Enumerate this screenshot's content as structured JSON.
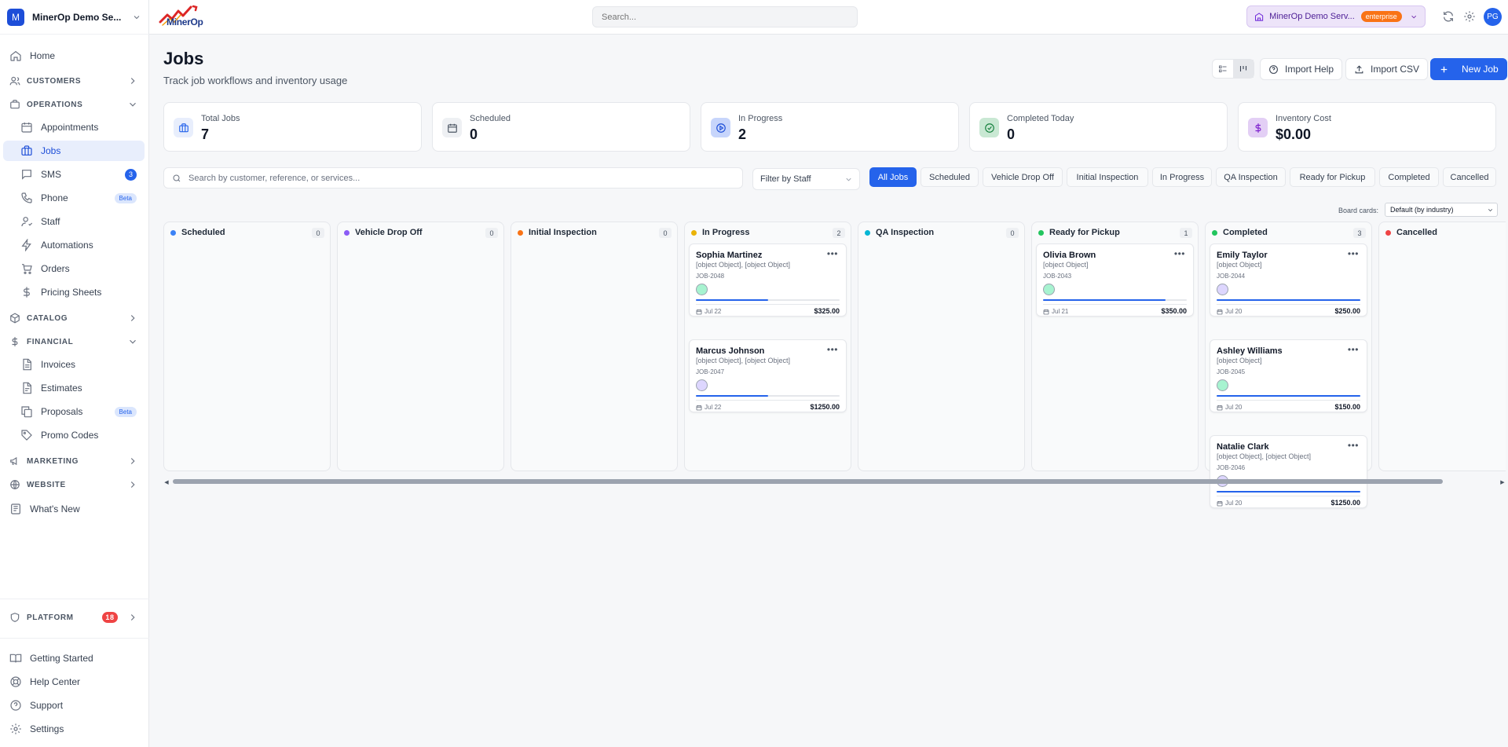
{
  "workspace": {
    "initial": "M",
    "name": "MinerOp Demo Se..."
  },
  "logo_text": "MinerOp",
  "topbar": {
    "search_placeholder": "Search...",
    "business_name": "MinerOp Demo Serv...",
    "plan_badge": "enterprise",
    "user_initials": "PG"
  },
  "sidebar": {
    "home": "Home",
    "sections": {
      "customers": "CUSTOMERS",
      "operations": "OPERATIONS",
      "catalog": "CATALOG",
      "financial": "FINANCIAL",
      "marketing": "MARKETING",
      "website": "WEBSITE",
      "platform": "PLATFORM"
    },
    "operations_items": {
      "appointments": "Appointments",
      "jobs": "Jobs",
      "sms": "SMS",
      "sms_count": "3",
      "phone": "Phone",
      "phone_badge": "Beta",
      "staff": "Staff",
      "automations": "Automations",
      "orders": "Orders",
      "pricing_sheets": "Pricing Sheets"
    },
    "financial_items": {
      "invoices": "Invoices",
      "estimates": "Estimates",
      "proposals": "Proposals",
      "proposals_badge": "Beta",
      "promo_codes": "Promo Codes"
    },
    "whats_new": "What's New",
    "platform_count": "18",
    "footer": {
      "getting_started": "Getting Started",
      "help_center": "Help Center",
      "support": "Support",
      "settings": "Settings"
    }
  },
  "page": {
    "title": "Jobs",
    "subtitle": "Track job workflows and inventory usage",
    "import_help": "Import Help",
    "import_csv": "Import CSV",
    "new_job": "New Job"
  },
  "stats": {
    "total": {
      "label": "Total Jobs",
      "value": "7",
      "color": "#2563eb"
    },
    "scheduled": {
      "label": "Scheduled",
      "value": "0",
      "color": "#4b5563"
    },
    "in_progress": {
      "label": "In Progress",
      "value": "2",
      "color": "#1d4ed8"
    },
    "completed_today": {
      "label": "Completed Today",
      "value": "0",
      "color": "#15803d"
    },
    "inventory_cost": {
      "label": "Inventory Cost",
      "value": "$0.00",
      "color": "#7e22ce"
    }
  },
  "filters": {
    "search_placeholder": "Search by customer, reference, or services...",
    "staff_filter": "Filter by Staff",
    "chips": {
      "all": "All Jobs",
      "scheduled": "Scheduled",
      "vehicle_drop_off": "Vehicle Drop Off",
      "initial_inspection": "Initial Inspection",
      "in_progress": "In Progress",
      "qa_inspection": "QA Inspection",
      "ready_for_pickup": "Ready for Pickup",
      "completed": "Completed",
      "cancelled": "Cancelled"
    }
  },
  "board": {
    "cards_label": "Board cards:",
    "cards_value": "Default (by industry)",
    "columns": {
      "scheduled": {
        "name": "Scheduled",
        "count": "0",
        "color": "#3b82f6"
      },
      "vehicle_drop_off": {
        "name": "Vehicle Drop Off",
        "count": "0",
        "color": "#8b5cf6"
      },
      "initial_inspection": {
        "name": "Initial Inspection",
        "count": "0",
        "color": "#f97316"
      },
      "in_progress": {
        "name": "In Progress",
        "count": "2",
        "color": "#eab308"
      },
      "qa_inspection": {
        "name": "QA Inspection",
        "count": "0",
        "color": "#06b6d4"
      },
      "ready_for_pickup": {
        "name": "Ready for Pickup",
        "count": "1",
        "color": "#22c55e"
      },
      "completed": {
        "name": "Completed",
        "count": "3",
        "color": "#22c55e"
      },
      "cancelled": {
        "name": "Cancelled",
        "color": "#ef4444"
      }
    },
    "cards": {
      "sophia": {
        "name": "Sophia Martinez",
        "services": "[object Object], [object Object]",
        "ref": "JOB-2048",
        "date": "Jul 22",
        "price": "$325.00",
        "progress": 0.5,
        "avatar_color": "#a7f3d0"
      },
      "marcus": {
        "name": "Marcus Johnson",
        "services": "[object Object], [object Object]",
        "ref": "JOB-2047",
        "date": "Jul 22",
        "price": "$1250.00",
        "progress": 0.5,
        "avatar_color": "#ddd6fe"
      },
      "olivia": {
        "name": "Olivia Brown",
        "services": "[object Object]",
        "ref": "JOB-2043",
        "date": "Jul 21",
        "price": "$350.00",
        "progress": 0.85,
        "avatar_color": "#a7f3d0"
      },
      "emily": {
        "name": "Emily Taylor",
        "services": "[object Object]",
        "ref": "JOB-2044",
        "date": "Jul 20",
        "price": "$250.00",
        "progress": 1.0,
        "avatar_color": "#ddd6fe"
      },
      "ashley": {
        "name": "Ashley Williams",
        "services": "[object Object]",
        "ref": "JOB-2045",
        "date": "Jul 20",
        "price": "$150.00",
        "progress": 1.0,
        "avatar_color": "#a7f3d0"
      },
      "natalie": {
        "name": "Natalie Clark",
        "services": "[object Object], [object Object]",
        "ref": "JOB-2046",
        "date": "Jul 20",
        "price": "$1250.00",
        "progress": 1.0,
        "avatar_color": "#ddd6fe"
      }
    }
  },
  "colors": {
    "accent": "#2563eb"
  }
}
